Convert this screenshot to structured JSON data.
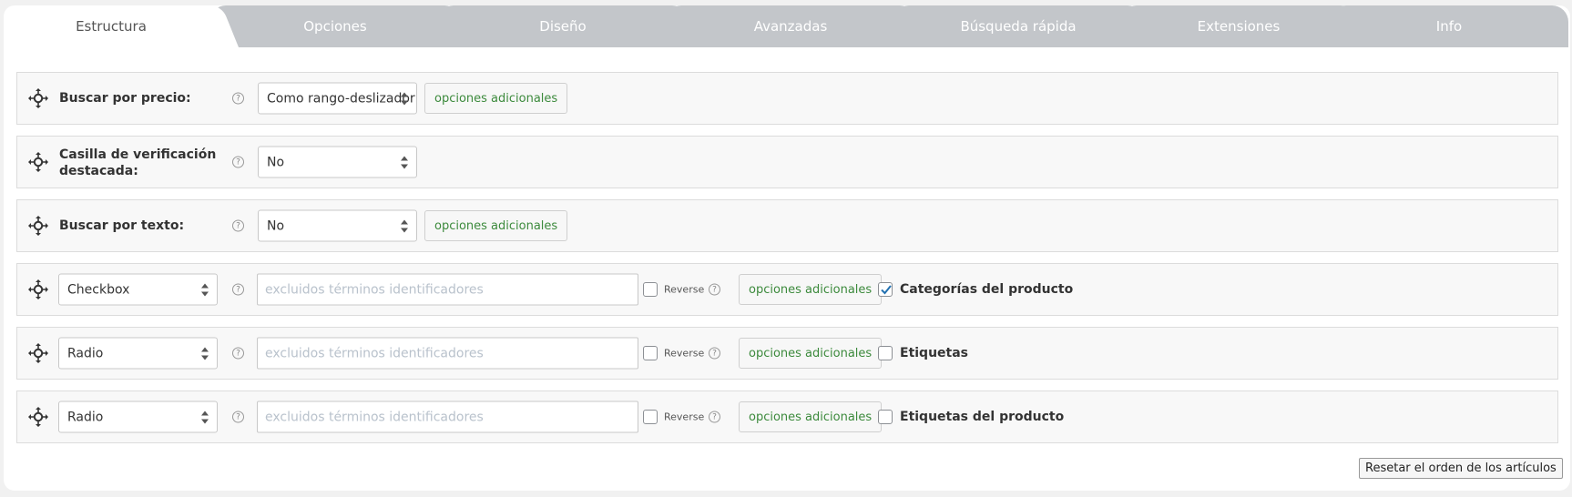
{
  "tabs": [
    {
      "label": "Estructura",
      "active": true
    },
    {
      "label": "Opciones"
    },
    {
      "label": "Diseño"
    },
    {
      "label": "Avanzadas"
    },
    {
      "label": "Búsqueda rápida"
    },
    {
      "label": "Extensiones"
    },
    {
      "label": "Info"
    }
  ],
  "help_glyph": "?",
  "rows": {
    "price": {
      "label": "Buscar por precio:",
      "select": "Como rango-deslizador",
      "button": "opciones adicionales"
    },
    "featured": {
      "label": "Casilla de verificación destacada:",
      "select": "No"
    },
    "text": {
      "label": "Buscar por texto:",
      "select": "No",
      "button": "opciones adicionales"
    },
    "categories": {
      "type": "Checkbox",
      "placeholder": "excluidos términos identificadores",
      "reverse": "Reverse",
      "button": "opciones adicionales",
      "taxonomy": "Categorías del producto",
      "checked": true
    },
    "tags": {
      "type": "Radio",
      "placeholder": "excluidos términos identificadores",
      "reverse": "Reverse",
      "button": "opciones adicionales",
      "taxonomy": "Etiquetas",
      "checked": false
    },
    "product_tags": {
      "type": "Radio",
      "placeholder": "excluidos términos identificadores",
      "reverse": "Reverse",
      "button": "opciones adicionales",
      "taxonomy": "Etiquetas del producto",
      "checked": false
    }
  },
  "footer": {
    "reset_label": "Resetar el orden de los artículos"
  },
  "colors": {
    "accent_green": "#3c8a3c",
    "checkbox_blue": "#2271b1",
    "tab_inactive": "#c3c6ca"
  }
}
